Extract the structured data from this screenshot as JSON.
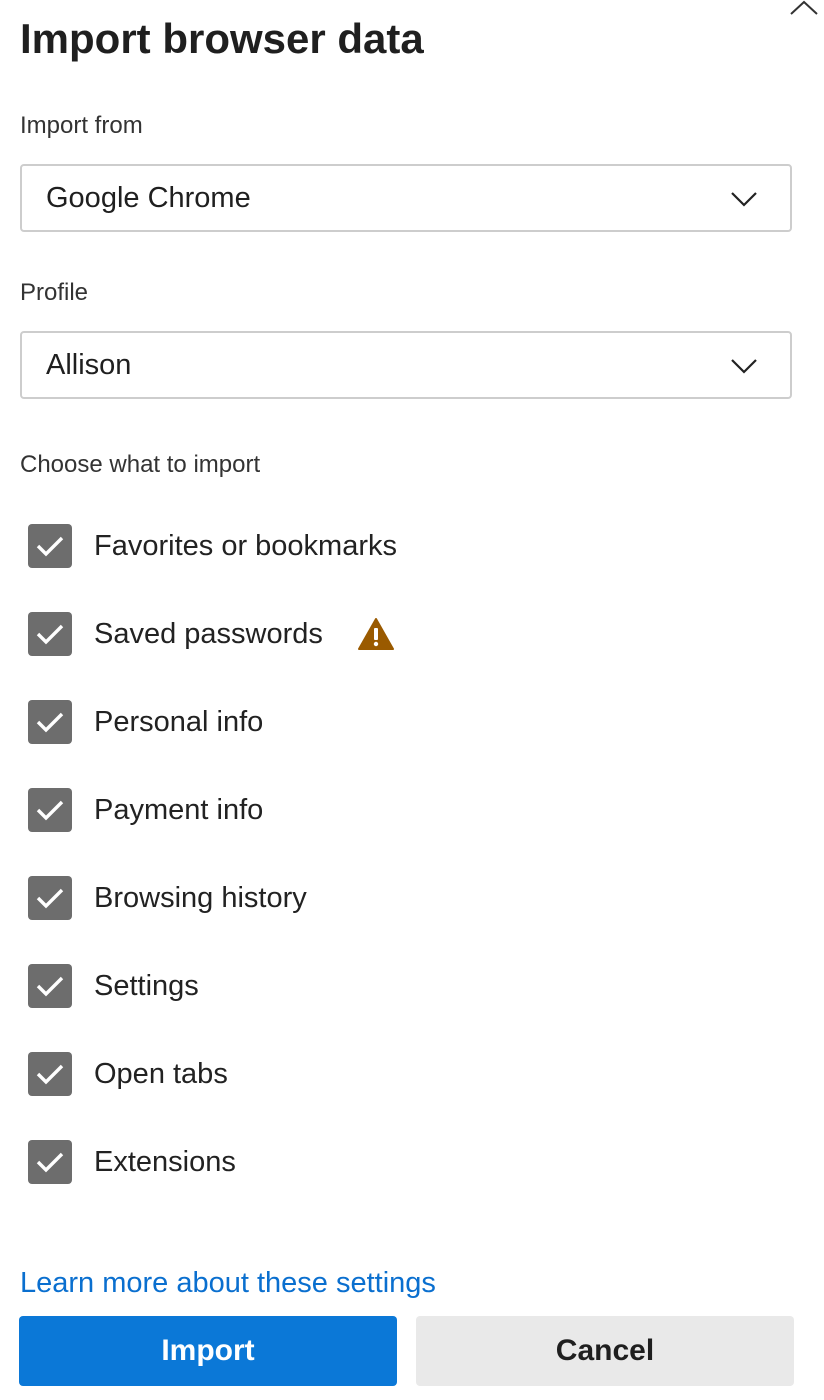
{
  "dialog": {
    "title": "Import browser data",
    "import_from": {
      "label": "Import from",
      "value": "Google Chrome",
      "icon": "chevron-down-icon"
    },
    "profile": {
      "label": "Profile",
      "value": "Allison",
      "icon": "chevron-down-icon"
    },
    "choose_label": "Choose what to import",
    "options": [
      {
        "label": "Favorites or bookmarks",
        "checked": true
      },
      {
        "label": "Saved passwords",
        "checked": true,
        "warning_icon": "warning-icon"
      },
      {
        "label": "Personal info",
        "checked": true
      },
      {
        "label": "Payment info",
        "checked": true
      },
      {
        "label": "Browsing history",
        "checked": true
      },
      {
        "label": "Settings",
        "checked": true
      },
      {
        "label": "Open tabs",
        "checked": true
      },
      {
        "label": "Extensions",
        "checked": true
      }
    ],
    "learn_more_link": "Learn more about these settings",
    "import_button": "Import",
    "cancel_button": "Cancel",
    "colors": {
      "accent": "#0b78d7",
      "link": "#0a6fcf",
      "checkbox_fill": "#6d6d6d",
      "warning": "#9a5a00"
    }
  }
}
